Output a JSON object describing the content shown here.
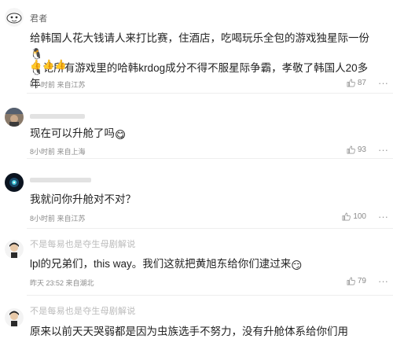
{
  "comments": [
    {
      "username": "君者",
      "text_line1": "给韩国人花大钱请人来打比赛，住酒店，吃喝玩乐全包的游戏独星际一份",
      "text_line2": "论所有游戏里的哈韩krdog成分不得不服星际争霸，孝敬了韩国人20多年",
      "reaction": "👍👍👍",
      "meta": "6小时前 来自江苏",
      "likes": "87"
    },
    {
      "username": "",
      "text": "现在可以升舱了吗",
      "meta": "8小时前 来自上海",
      "likes": "93"
    },
    {
      "username": "",
      "text": "我就问你升舱对不对？",
      "meta": "8小时前 来自江苏",
      "likes": "100"
    },
    {
      "username": "不是每易也是夺生母剧解说",
      "text": "lpl的兄弟们，this way。我们这就把黄旭东给你们逮过来",
      "meta": "昨天 23:52 来自湖北",
      "likes": "79"
    },
    {
      "username": "不是每易也是夺生母剧解说",
      "text": "原来以前天天哭弱都是因为虫族选手不努力，没有升舱体系给你们用",
      "meta": "",
      "likes": ""
    }
  ],
  "more_icon": "ellipsis-icon",
  "like_icon": "thumbs-up-icon"
}
